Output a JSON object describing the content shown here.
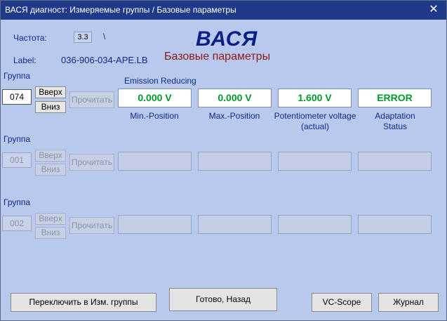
{
  "window": {
    "title": "ВАСЯ диагност: Измеряемые группы / Базовые параметры",
    "close_glyph": "✕"
  },
  "header": {
    "freq_label": "Частота:",
    "freq_value": "3.3",
    "freq_extra": "\\",
    "label_label": "Label:",
    "label_value": "036-906-034-APE.LB",
    "brand": "ВАСЯ",
    "subtitle": "Базовые параметры"
  },
  "groups": [
    {
      "label": "Группа",
      "number": "074",
      "up": "Вверх",
      "down": "Вниз",
      "read": "Прочитать",
      "block_title": "Emission Reducing",
      "fields": [
        "0.000 V",
        "0.000 V",
        "1.600 V",
        "ERROR"
      ],
      "captions": [
        "Min.-Position",
        "Max.-Position",
        "Potentiometer voltage (actual)",
        "Adaptation Status"
      ]
    },
    {
      "label": "Группа",
      "number": "001",
      "up": "Вверх",
      "down": "Вниз",
      "read": "Прочитать"
    },
    {
      "label": "Группа",
      "number": "002",
      "up": "Вверх",
      "down": "Вниз",
      "read": "Прочитать"
    }
  ],
  "footer": {
    "switch": "Переключить в Изм. группы",
    "done": "Готово, Назад",
    "vcscope": "VC-Scope",
    "journal": "Журнал"
  },
  "colors": {
    "title_bar": "#1f3a88",
    "background": "#b9c9ee",
    "value_green": "#009a2a",
    "brand_blue": "#0c1f88",
    "subtitle_red": "#8a1a1a"
  }
}
